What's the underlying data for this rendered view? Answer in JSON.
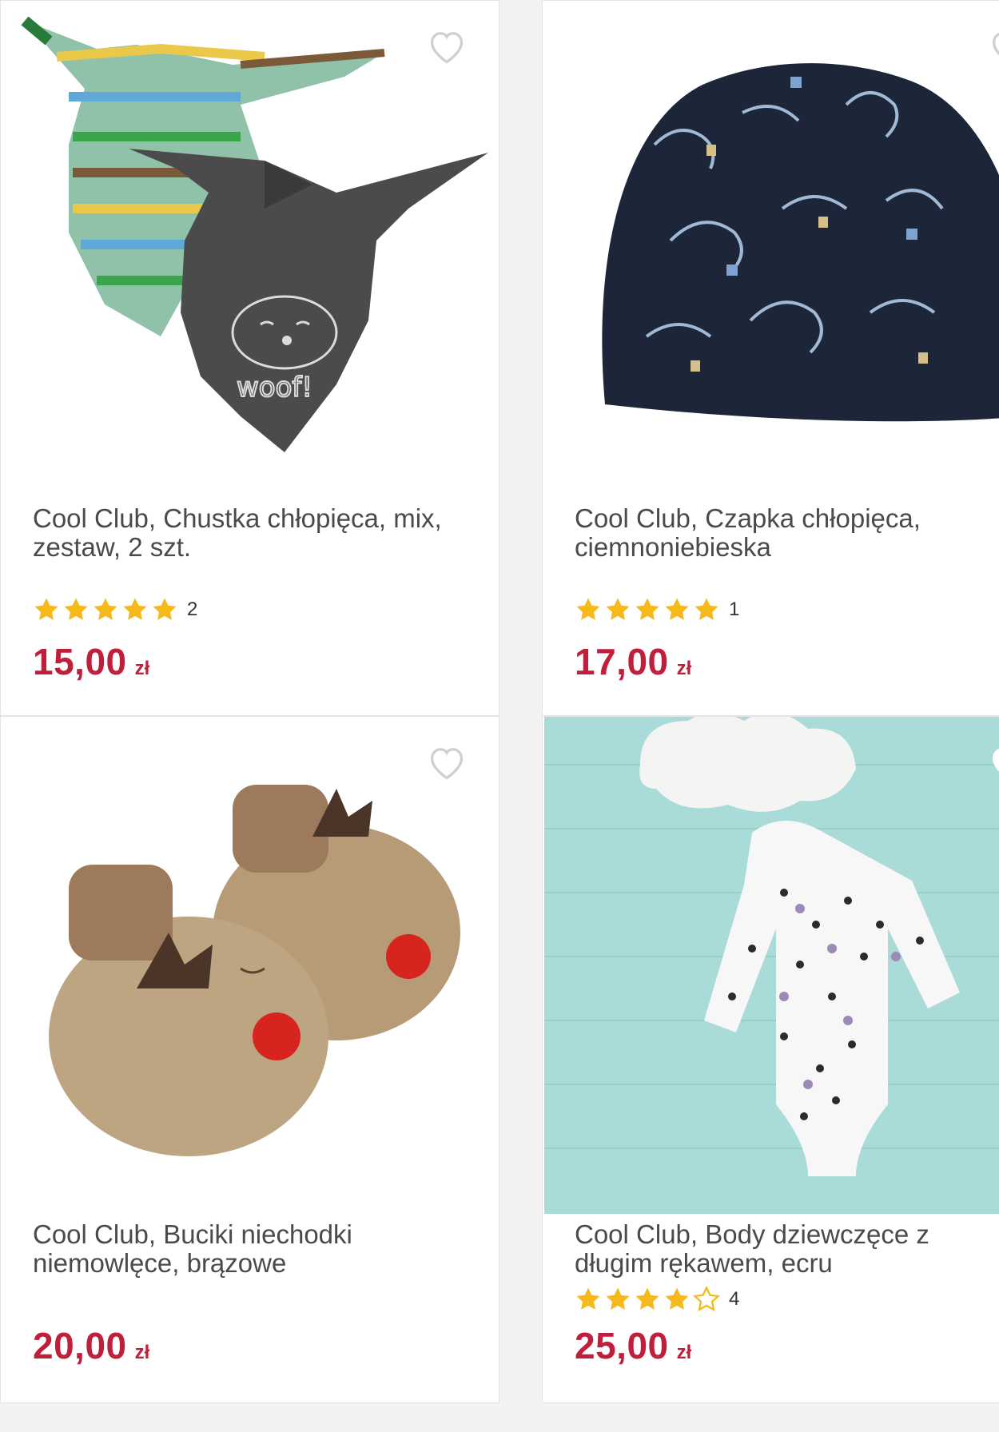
{
  "colors": {
    "price": "#c01f3c",
    "star": "#f6b81a",
    "title": "#4a4a4a"
  },
  "products": [
    {
      "title": "Cool Club, Chustka chłopięca, mix, zestaw, 2 szt.",
      "rating": 5,
      "rating_count": "2",
      "price": "15,00",
      "currency": "zł",
      "image": "striped-and-grey-bandana-scarves-image",
      "favorite_icon": "heart-outline-icon"
    },
    {
      "title": "Cool Club, Czapka chłopięca, ciemnoniebieska",
      "rating": 5,
      "rating_count": "1",
      "price": "17,00",
      "currency": "zł",
      "image": "navy-dinosaur-beanie-image",
      "favorite_icon": "heart-outline-icon"
    },
    {
      "title": "Cool Club, Buciki niechodki niemowlęce, brązowe",
      "rating": 0,
      "rating_count": "",
      "price": "20,00",
      "currency": "zł",
      "image": "reindeer-baby-slippers-image",
      "favorite_icon": "heart-outline-icon"
    },
    {
      "title": "Cool Club, Body dziewczęce z długim rękawem, ecru",
      "rating": 4,
      "rating_count": "4",
      "price": "25,00",
      "currency": "zł",
      "image": "dotted-baby-bodysuit-image",
      "favorite_icon": "heart-filled-icon"
    }
  ]
}
